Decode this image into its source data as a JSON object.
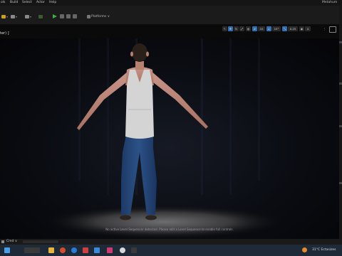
{
  "menu": {
    "items": [
      "ols",
      "Build",
      "Select",
      "Actor",
      "Help"
    ],
    "right_label": "Metahum"
  },
  "toolbar": {
    "platforms_label": "Platforms ∨"
  },
  "viewport": {
    "title": "ter) ]",
    "toolbar_values": [
      "10",
      "10°",
      "0.25",
      "4"
    ],
    "notice": "No active Level Sequencer detected. Please edit a Level Sequence to enable full controls."
  },
  "status": {
    "left": "Cmd ∨"
  },
  "taskbar": {
    "weather": "31°C  Ectasizes"
  },
  "colors": {
    "play": "#3fae48",
    "accent": "#2f6fb0",
    "taskbar": "#1e2a38"
  }
}
